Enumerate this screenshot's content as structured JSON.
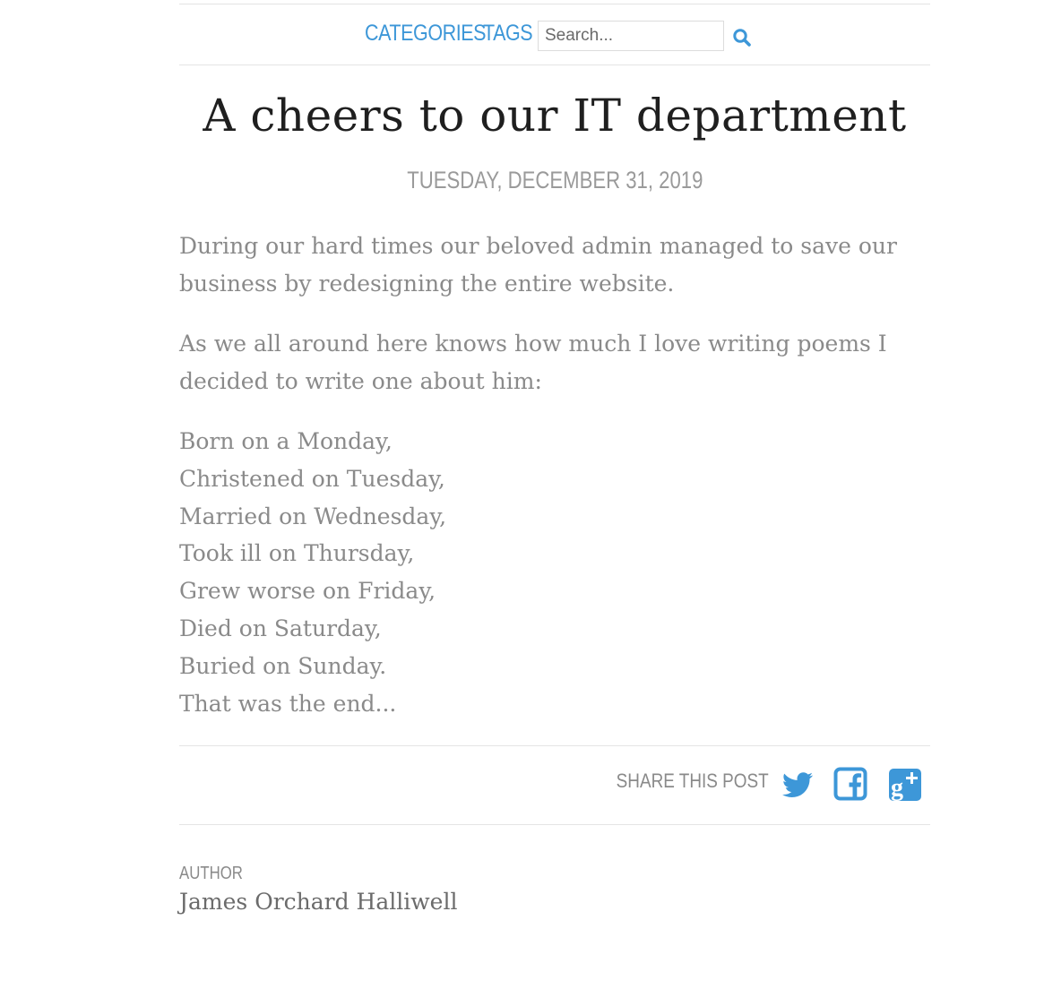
{
  "nav": {
    "categories_label": "Categories",
    "tags_label": "Tags",
    "search_placeholder": "Search...",
    "search_icon": "search-icon",
    "link_color": "#3d97d8"
  },
  "post": {
    "title": "A cheers to our IT department",
    "date": "Tuesday, December 31, 2019",
    "paragraphs": [
      "During our hard times our beloved admin managed to save our business by redesigning the entire website.",
      "As we all around here knows how much I love writing poems I decided to write one about him:"
    ],
    "poem": [
      "Born on a Monday,",
      "Christened on Tuesday,",
      "Married on Wednesday,",
      "Took ill on Thursday,",
      "Grew worse on Friday,",
      "Died on Saturday,",
      "Buried on Sunday.",
      "That was the end..."
    ]
  },
  "share": {
    "label": "Share this post",
    "icons": [
      "twitter-icon",
      "facebook-icon",
      "google-plus-icon"
    ],
    "icon_color": "#3d97d8"
  },
  "author": {
    "label": "Author",
    "name": "James Orchard Halliwell"
  }
}
